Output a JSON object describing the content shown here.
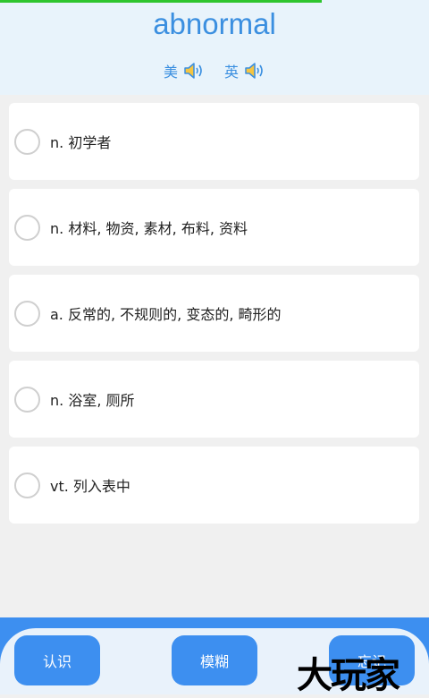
{
  "progress": 0.75,
  "word": "abnormal",
  "pronunciations": [
    {
      "label": "美",
      "icon": "speaker-icon"
    },
    {
      "label": "英",
      "icon": "speaker-icon"
    }
  ],
  "options": [
    {
      "text": "n. 初学者"
    },
    {
      "text": "n. 材料, 物资, 素材, 布料, 资料"
    },
    {
      "text": "a. 反常的, 不规则的, 变态的, 畸形的"
    },
    {
      "text": "n. 浴室, 厕所"
    },
    {
      "text": "vt. 列入表中"
    }
  ],
  "buttons": {
    "know": "认识",
    "fuzzy": "模糊",
    "forget": "忘记"
  },
  "watermark": "大玩家",
  "colors": {
    "accent": "#3b8fe0",
    "progress": "#2ec52e",
    "button": "#3d8ff0"
  }
}
